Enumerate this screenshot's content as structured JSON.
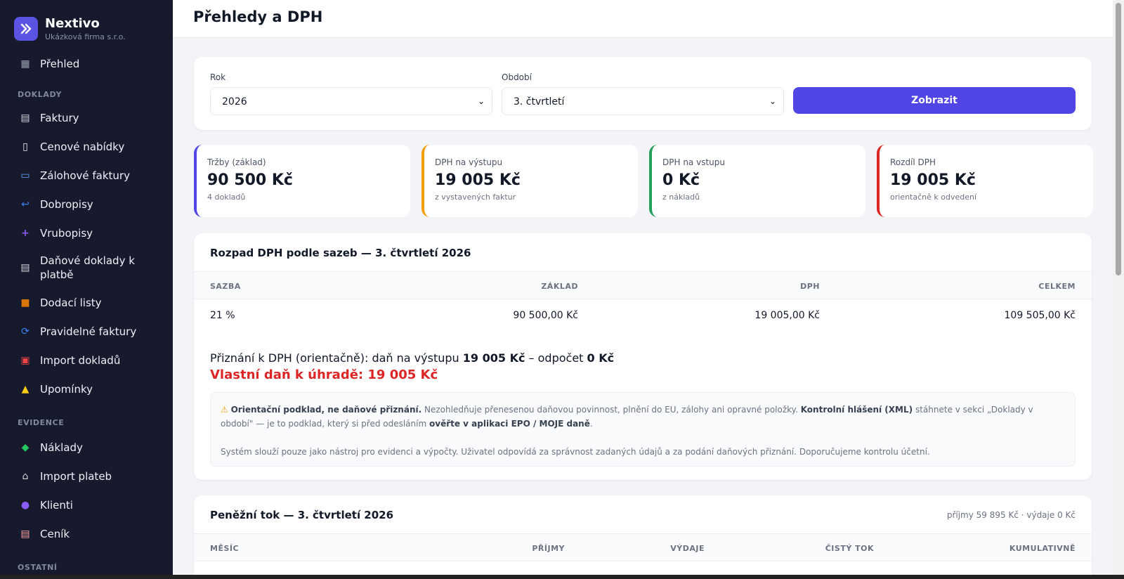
{
  "brand": {
    "name": "Nextivo",
    "company": "Ukázková firma s.r.o."
  },
  "sidebar": {
    "overview": {
      "label": "Přehled",
      "icon": "grid-icon"
    },
    "sections": {
      "doklady": "DOKLADY",
      "evidence": "EVIDENCE",
      "ostatni": "OSTATNÍ"
    },
    "doklady_items": [
      {
        "label": "Faktury",
        "icon": "invoice-icon"
      },
      {
        "label": "Cenové nabídky",
        "icon": "document-icon"
      },
      {
        "label": "Zálohové faktury",
        "icon": "card-icon"
      },
      {
        "label": "Dobropisy",
        "icon": "return-icon"
      },
      {
        "label": "Vrubopisy",
        "icon": "plus-icon"
      },
      {
        "label": "Daňové doklady k platbě",
        "icon": "receipt-icon"
      },
      {
        "label": "Dodací listy",
        "icon": "package-icon"
      },
      {
        "label": "Pravidelné faktury",
        "icon": "repeat-icon"
      },
      {
        "label": "Import dokladů",
        "icon": "inbox-icon"
      },
      {
        "label": "Upomínky",
        "icon": "bell-icon"
      }
    ],
    "evidence_items": [
      {
        "label": "Náklady",
        "icon": "money-icon"
      },
      {
        "label": "Import plateb",
        "icon": "bank-icon"
      },
      {
        "label": "Klienti",
        "icon": "user-icon"
      },
      {
        "label": "Ceník",
        "icon": "pricelist-icon"
      }
    ]
  },
  "page": {
    "title": "Přehledy a DPH"
  },
  "filters": {
    "year_label": "Rok",
    "year_value": "2026",
    "period_label": "Období",
    "period_value": "3. čtvrtletí",
    "submit_label": "Zobrazit"
  },
  "stats": [
    {
      "label": "Tržby (základ)",
      "value": "90 500 Kč",
      "sub": "4 dokladů",
      "color": "#4f46e5"
    },
    {
      "label": "DPH na výstupu",
      "value": "19 005 Kč",
      "sub": "z vystavených faktur",
      "color": "#f59e0b"
    },
    {
      "label": "DPH na vstupu",
      "value": "0 Kč",
      "sub": "z nákladů",
      "color": "#22a05a"
    },
    {
      "label": "Rozdíl DPH",
      "value": "19 005 Kč",
      "sub": "orientačně k odvedení",
      "color": "#dc2626"
    }
  ],
  "vat": {
    "title": "Rozpad DPH podle sazeb — 3. čtvrtletí 2026",
    "headers": [
      "SAZBA",
      "ZÁKLAD",
      "DPH",
      "CELKEM"
    ],
    "rows": [
      {
        "rate": "21 %",
        "base": "90 500,00 Kč",
        "vat": "19 005,00 Kč",
        "total": "109 505,00 Kč"
      }
    ],
    "summary_prefix": "Přiznání k DPH (orientačně): daň na výstupu",
    "summary_output": "19 005 Kč",
    "summary_mid": "– odpočet",
    "summary_deduction": "0 Kč",
    "own_tax": "Vlastní daň k úhradě: 19 005 Kč",
    "notice": {
      "strong1": "Orientační podklad, ne daňové přiznání.",
      "text1": "Nezohledňuje přenesenou daňovou povinnost, plnění do EU, zálohy ani opravné položky.",
      "strong2": "Kontrolní hlášení (XML)",
      "text2": "stáhnete v sekci „Doklady v období\" — je to podklad, který si před odesláním",
      "strong3": "ověřte v aplikaci EPO / MOJE daně",
      "text3": ".",
      "text4": "Systém slouží pouze jako nástroj pro evidenci a výpočty. Uživatel odpovídá za správnost zadaných údajů a za podání daňových přiznání. Doporučujeme kontrolu účetní."
    }
  },
  "cash": {
    "title": "Peněžní tok — 3. čtvrtletí 2026",
    "meta": "příjmy 59 895 Kč · výdaje 0 Kč",
    "headers": [
      "MĚSÍC",
      "PŘÍJMY",
      "VÝDAJE",
      "ČISTÝ TOK",
      "KUMULATIVNĚ"
    ]
  }
}
